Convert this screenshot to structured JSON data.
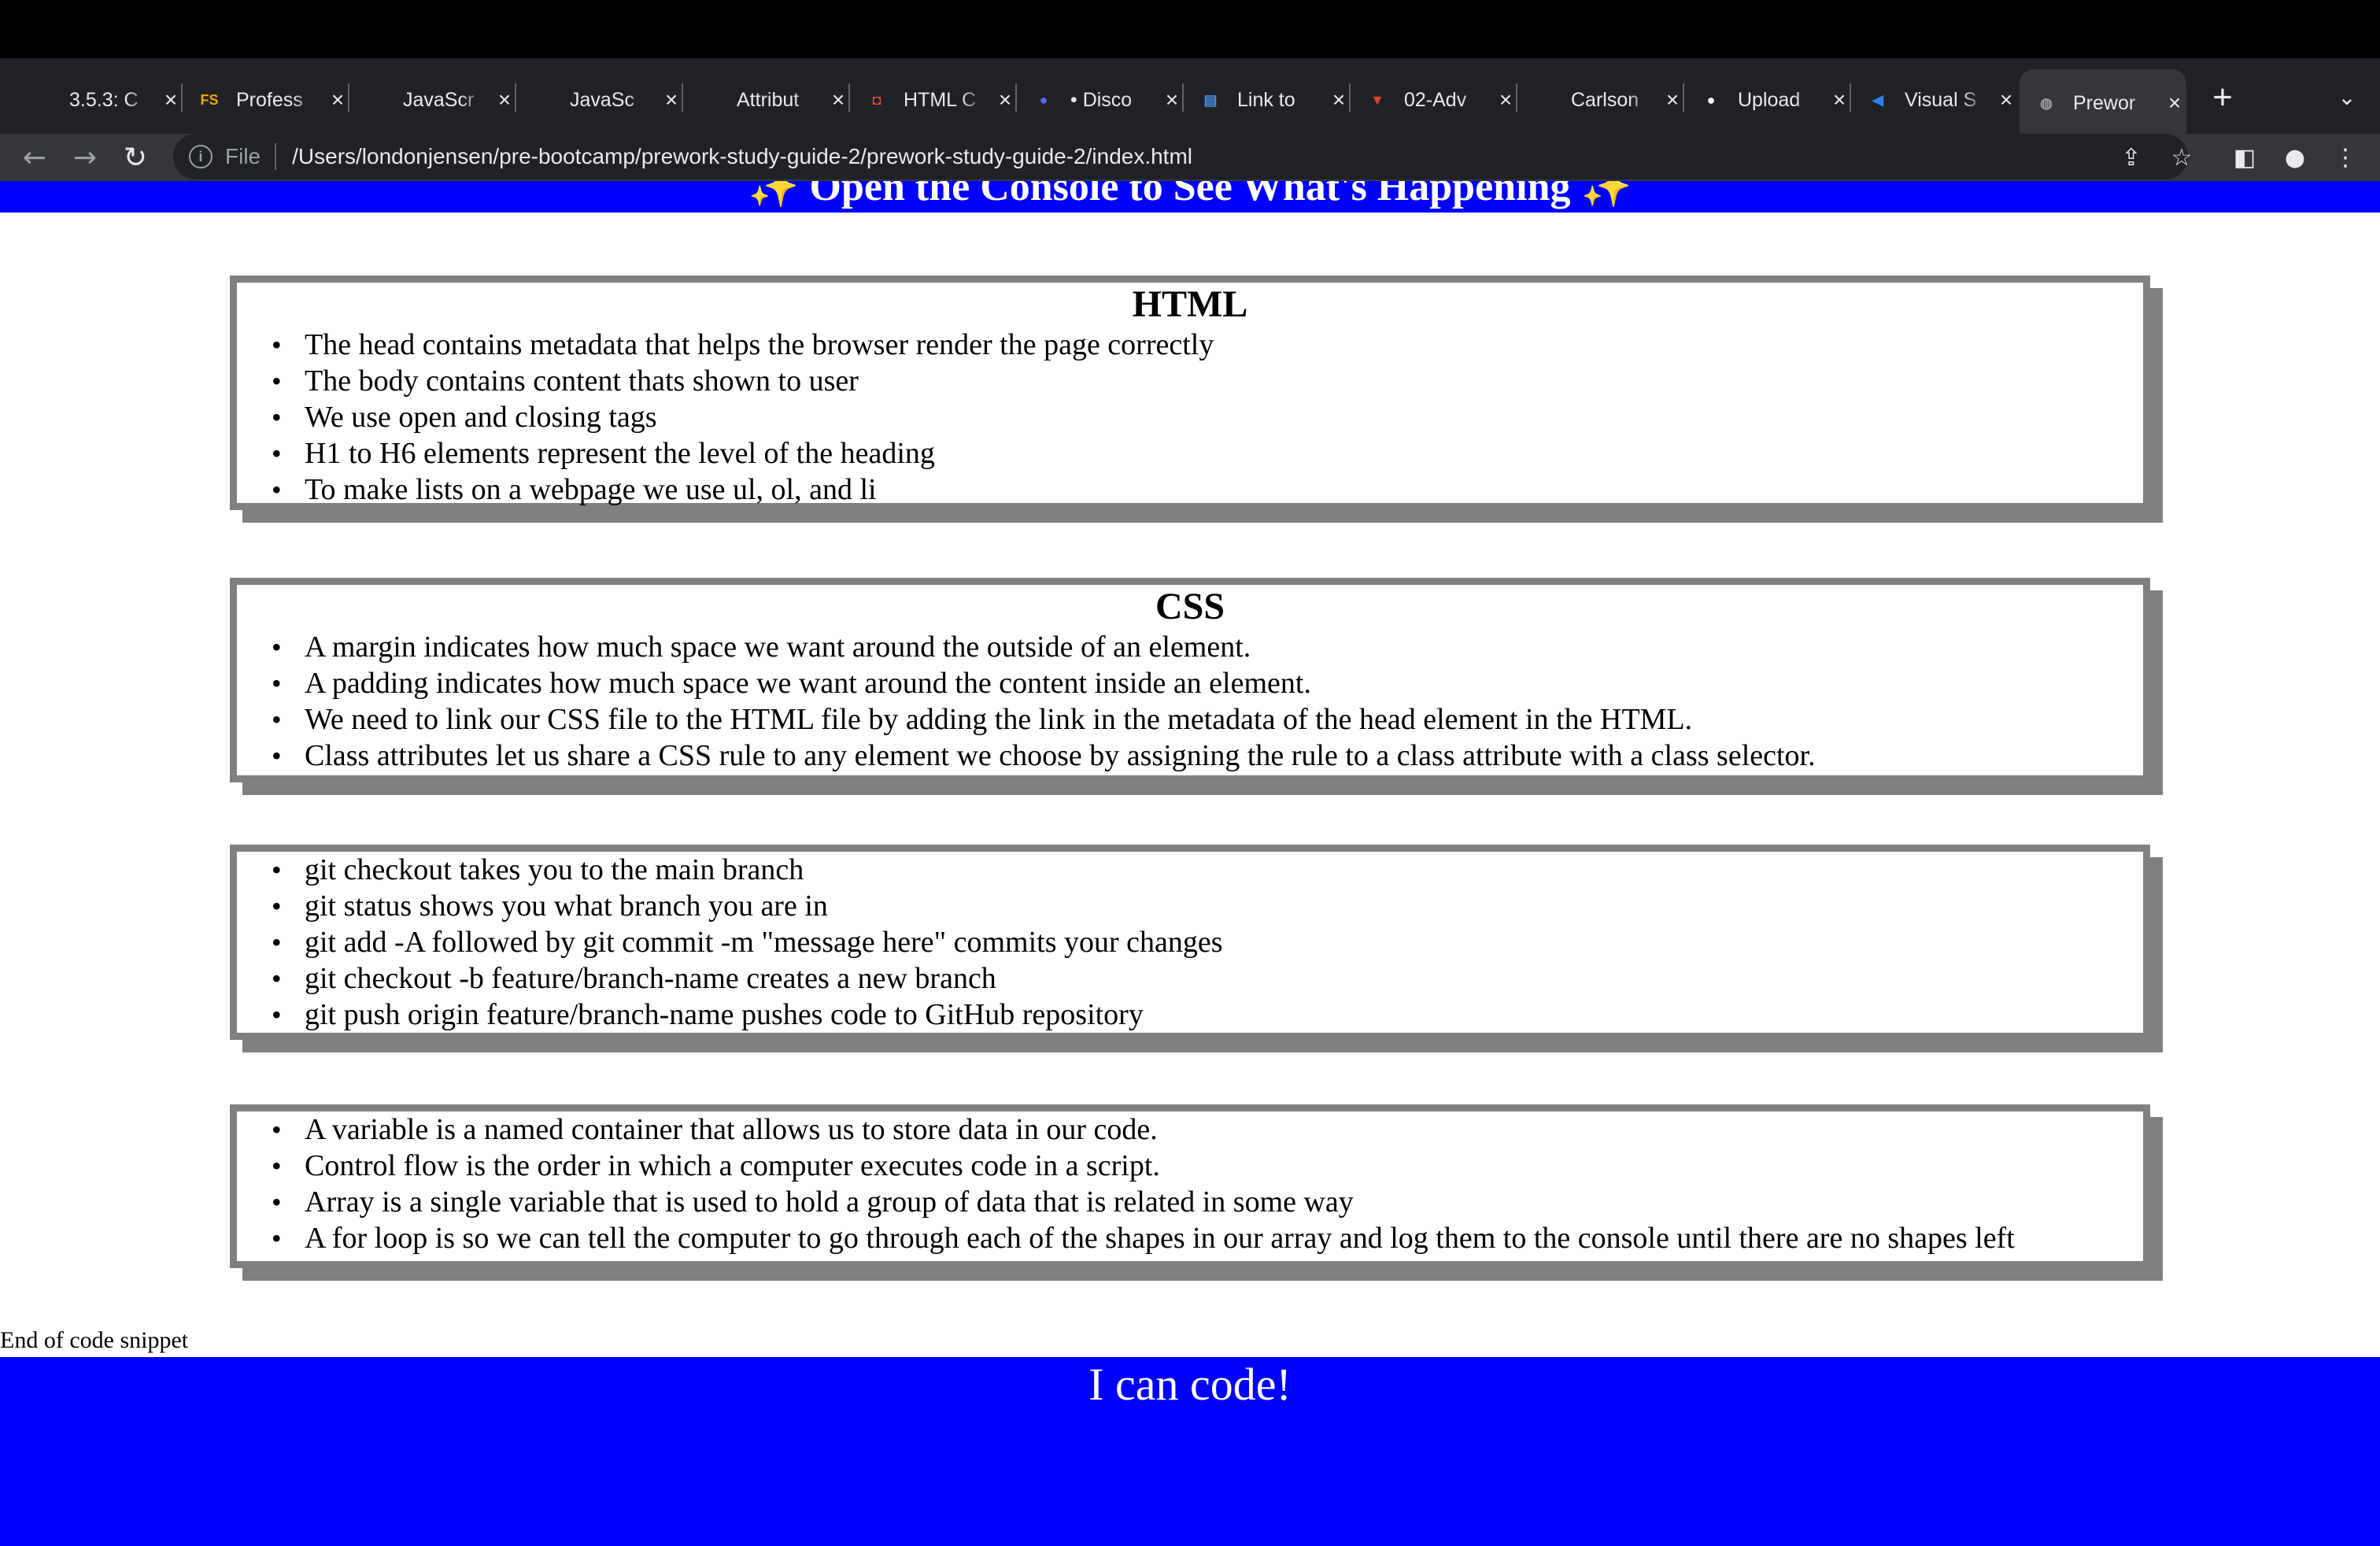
{
  "browser": {
    "tabs": [
      {
        "title": "3.5.3: C",
        "icon": "module-icon",
        "color": "#f5c518",
        "glyph": "",
        "active": false
      },
      {
        "title": "Profess",
        "icon": "fs-icon",
        "color": "#f0a30a",
        "glyph": "FS",
        "active": false
      },
      {
        "title": "JavaScr",
        "icon": "mdn-icon",
        "color": "#202124",
        "glyph": "M",
        "active": false
      },
      {
        "title": "JavaSc",
        "icon": "mdn-icon",
        "color": "#202124",
        "glyph": "M",
        "active": false
      },
      {
        "title": "Attribut",
        "icon": "mdn-icon",
        "color": "#202124",
        "glyph": "M",
        "active": false
      },
      {
        "title": "HTML C",
        "icon": "html-icon",
        "color": "#e8453c",
        "glyph": "◘",
        "active": false
      },
      {
        "title": "• Disco",
        "icon": "discord-icon",
        "color": "#5865f2",
        "glyph": "●",
        "active": false
      },
      {
        "title": "Link to",
        "icon": "book-icon",
        "color": "#4a90e2",
        "glyph": "▤",
        "active": false
      },
      {
        "title": "02-Adv",
        "icon": "gitlab-icon",
        "color": "#e24329",
        "glyph": "▼",
        "active": false
      },
      {
        "title": "Carlson",
        "icon": "code-icon",
        "color": "#202124",
        "glyph": "</>",
        "active": false
      },
      {
        "title": "Upload",
        "icon": "github-icon",
        "color": "#ffffff",
        "glyph": "●",
        "active": false
      },
      {
        "title": "Visual S",
        "icon": "vscode-icon",
        "color": "#2f80ed",
        "glyph": "◀",
        "active": false
      },
      {
        "title": "Prewor",
        "icon": "globe-icon",
        "color": "#9aa0a6",
        "glyph": "◍",
        "active": true
      }
    ],
    "new_tab": "+",
    "address": {
      "file_label": "File",
      "url": "/Users/londonjensen/pre-bootcamp/prework-study-guide-2/prework-study-guide-2/index.html"
    }
  },
  "page": {
    "header": "✨ Open the Console to See What's Happening ✨",
    "sections": [
      {
        "title": "HTML",
        "items": [
          "The head contains metadata that helps the browser render the page correctly",
          "The body contains content thats shown to user",
          "We use open and closing tags",
          "H1 to H6 elements represent the level of the heading",
          "To make lists on a webpage we use ul, ol, and li"
        ]
      },
      {
        "title": "CSS",
        "items": [
          "A margin indicates how much space we want around the outside of an element.",
          "A padding indicates how much space we want around the content inside an element.",
          "We need to link our CSS file to the HTML file by adding the link in the metadata of the head element in the HTML.",
          "Class attributes let us share a CSS rule to any element we choose by assigning the rule to a class attribute with a class selector."
        ]
      },
      {
        "title": "",
        "items": [
          "git checkout takes you to the main branch",
          "git status shows you what branch you are in",
          "git add -A followed by git commit -m \"message here\" commits your changes",
          "git checkout -b feature/branch-name creates a new branch",
          "git push origin feature/branch-name pushes code to GitHub repository"
        ]
      },
      {
        "title": "",
        "items": [
          "A variable is a named container that allows us to store data in our code.",
          "Control flow is the order in which a computer executes code in a script.",
          "Array is a single variable that is used to hold a group of data that is related in some way",
          "A for loop is so we can tell the computer to go through each of the shapes in our array and log them to the console until there are no shapes left"
        ]
      }
    ],
    "end_note": "End of code snippet",
    "footer": "I can code!"
  }
}
